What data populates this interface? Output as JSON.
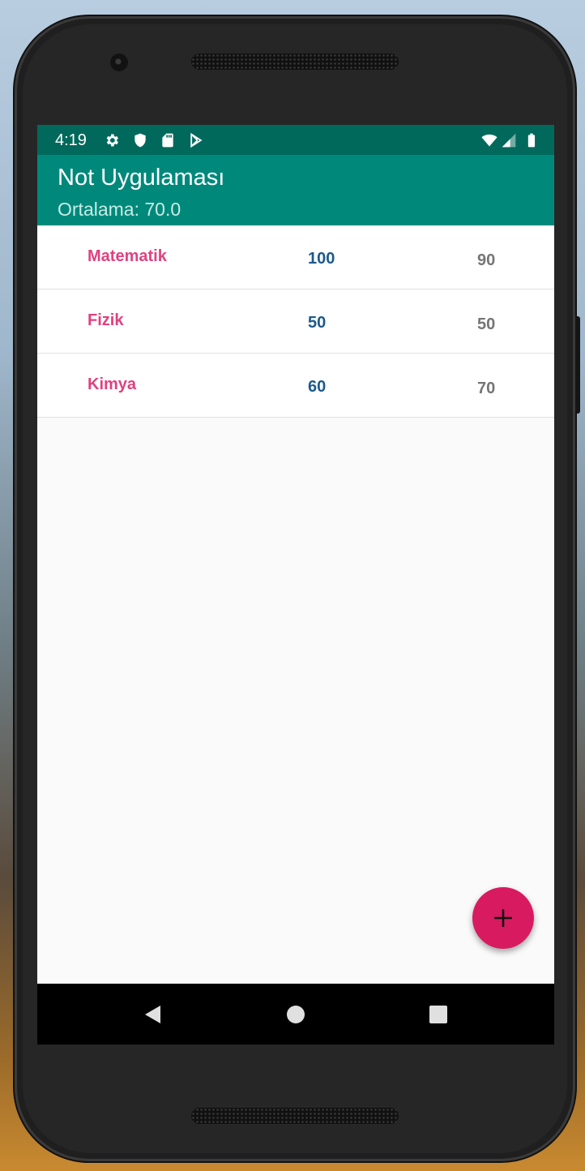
{
  "status_bar": {
    "time": "4:19",
    "left_icons": [
      "settings-icon",
      "shield-icon",
      "sd-card-icon",
      "play-store-icon"
    ],
    "right_icons": [
      "wifi-icon",
      "cellular-signal-icon",
      "battery-icon"
    ],
    "background": "#00695c"
  },
  "app_bar": {
    "title": "Not Uygulaması",
    "subtitle": "Ortalama: 70.0",
    "background": "#00897b"
  },
  "grades": [
    {
      "course": "Matematik",
      "grade1": "100",
      "grade2": "90"
    },
    {
      "course": "Fizik",
      "grade1": "50",
      "grade2": "50"
    },
    {
      "course": "Kimya",
      "grade1": "60",
      "grade2": "70"
    }
  ],
  "colors": {
    "course": "#e0417f",
    "grade1": "#1c5a8c",
    "grade2": "#757575",
    "fab": "#d81b60"
  },
  "fab": {
    "icon": "plus-icon"
  },
  "nav_bar": {
    "icons": [
      "back-icon",
      "home-icon",
      "recents-icon"
    ]
  }
}
